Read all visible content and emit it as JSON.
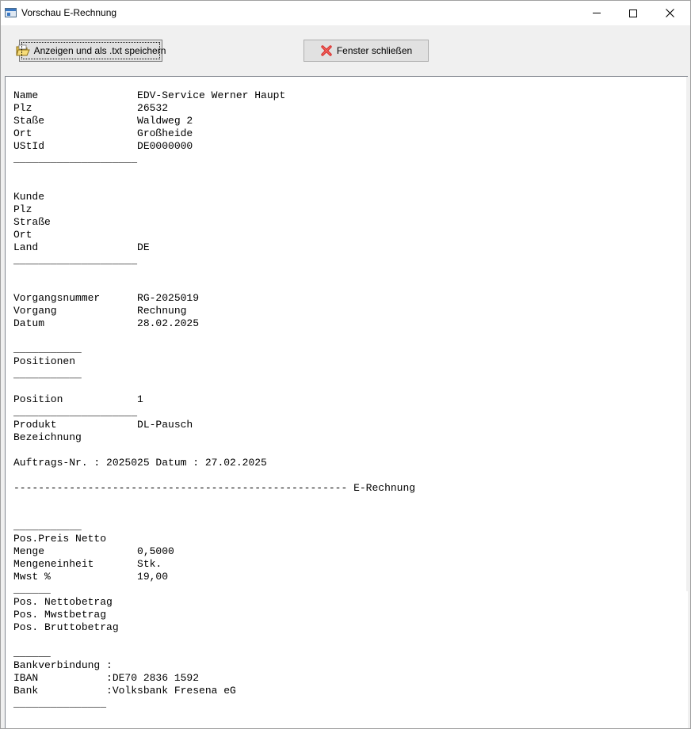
{
  "window": {
    "title": "Vorschau E-Rechnung"
  },
  "toolbar": {
    "show_save_label": "Anzeigen  und als .txt speichern",
    "close_label": "Fenster schließen"
  },
  "preview": {
    "text": "Name                EDV-Service Werner Haupt\nPlz                 26532\nStaße               Waldweg 2\nOrt                 Großheide\nUStId               DE0000000\n____________________\n\n\nKunde\nPlz\nStraße\nOrt\nLand                DE\n____________________\n\n\nVorgangsnummer      RG-2025019\nVorgang             Rechnung\nDatum               28.02.2025\n\n___________\nPositionen\n___________\n\nPosition            1\n____________________\nProdukt             DL-Pausch\nBezeichnung\n\nAuftrags-Nr. : 2025025 Datum : 27.02.2025\n\n------------------------------------------------------ E-Rechnung\n\n\n___________\nPos.Preis Netto\nMenge               0,5000\nMengeneinheit       Stk.\nMwst %              19,00\n______\nPos. Nettobetrag\nPos. Mwstbetrag\nPos. Bruttobetrag\n\n______\nBankverbindung :\nIBAN           :DE70 2836 1592\nBank           :Volksbank Fresena eG\n_______________"
  }
}
